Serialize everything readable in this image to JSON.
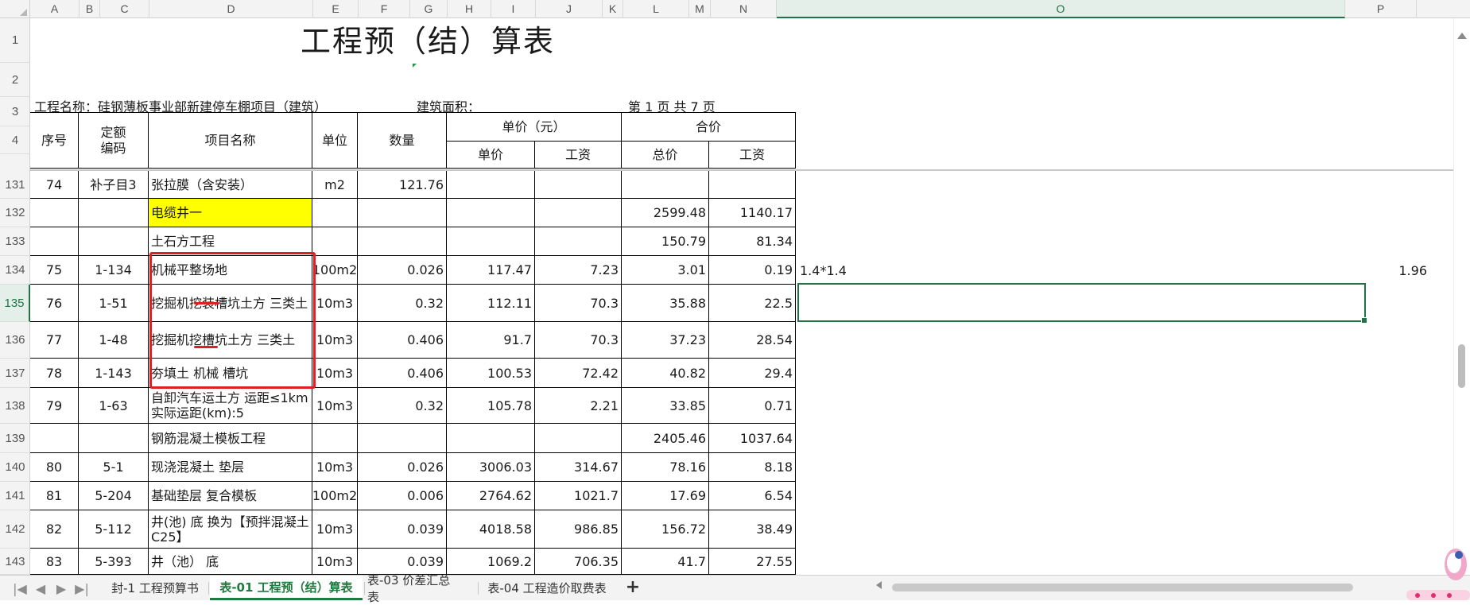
{
  "columns": [
    {
      "name": "A",
      "width": 62
    },
    {
      "name": "B",
      "width": 26
    },
    {
      "name": "C",
      "width": 62
    },
    {
      "name": "D",
      "width": 206
    },
    {
      "name": "E",
      "width": 57
    },
    {
      "name": "F",
      "width": 65
    },
    {
      "name": "G",
      "width": 47
    },
    {
      "name": "H",
      "width": 55
    },
    {
      "name": "I",
      "width": 56
    },
    {
      "name": "J",
      "width": 84
    },
    {
      "name": "K",
      "width": 26
    },
    {
      "name": "L",
      "width": 83
    },
    {
      "name": "M",
      "width": 27
    },
    {
      "name": "N",
      "width": 83
    },
    {
      "name": "O",
      "width": 715
    },
    {
      "name": "P",
      "width": 90
    }
  ],
  "row_labels": [
    "1",
    "2",
    "3",
    "4",
    "131",
    "132",
    "133",
    "134",
    "135",
    "136",
    "137",
    "138",
    "139",
    "140",
    "141",
    "142",
    "143"
  ],
  "selected_row": "135",
  "selected_column": "O",
  "sheet": {
    "title": "工程预（结）算表",
    "project_name": "工程名称：硅钢薄板事业部新建停车棚项目（建筑）",
    "building_area": "建筑面积：",
    "page_info": "第  1  页  共  7  页",
    "headers": {
      "seq": "序号",
      "quota_code": "定额\n编码",
      "item_name": "项目名称",
      "unit": "单位",
      "quantity": "数量",
      "unit_price_group": "单价（元）",
      "unit_price": "单价",
      "wage": "工资",
      "total_group": "合价",
      "total_price": "总价",
      "total_wage": "工资"
    },
    "rows": [
      {
        "row": "131",
        "seq": "74",
        "code": "补子目3",
        "name": "张拉膜（含安装）",
        "unit": "m2",
        "qty": "121.76",
        "price": "",
        "wage": "",
        "total": "",
        "twage": "",
        "highlight": false
      },
      {
        "row": "132",
        "seq": "",
        "code": "",
        "name": "电缆井一",
        "unit": "",
        "qty": "",
        "price": "",
        "wage": "",
        "total": "2599.48",
        "twage": "1140.17",
        "highlight": true
      },
      {
        "row": "133",
        "seq": "",
        "code": "",
        "name": "土石方工程",
        "unit": "",
        "qty": "",
        "price": "",
        "wage": "",
        "total": "150.79",
        "twage": "81.34",
        "highlight": false
      },
      {
        "row": "134",
        "seq": "75",
        "code": "1-134",
        "name": "机械平整场地",
        "unit": "100m2",
        "qty": "0.026",
        "price": "117.47",
        "wage": "7.23",
        "total": "3.01",
        "twage": "0.19",
        "highlight": false
      },
      {
        "row": "135",
        "seq": "76",
        "code": "1-51",
        "name": "挖掘机挖装槽坑土方 三类土",
        "unit": "10m3",
        "qty": "0.32",
        "price": "112.11",
        "wage": "70.3",
        "total": "35.88",
        "twage": "22.5",
        "highlight": false
      },
      {
        "row": "136",
        "seq": "77",
        "code": "1-48",
        "name": "挖掘机挖槽坑土方 三类土",
        "unit": "10m3",
        "qty": "0.406",
        "price": "91.7",
        "wage": "70.3",
        "total": "37.23",
        "twage": "28.54",
        "highlight": false
      },
      {
        "row": "137",
        "seq": "78",
        "code": "1-143",
        "name": "夯填土 机械 槽坑",
        "unit": "10m3",
        "qty": "0.406",
        "price": "100.53",
        "wage": "72.42",
        "total": "40.82",
        "twage": "29.4",
        "highlight": false
      },
      {
        "row": "138",
        "seq": "79",
        "code": "1-63",
        "name": "自卸汽车运土方 运距≤1km  实际运距(km):5",
        "unit": "10m3",
        "qty": "0.32",
        "price": "105.78",
        "wage": "2.21",
        "total": "33.85",
        "twage": "0.71",
        "highlight": false
      },
      {
        "row": "139",
        "seq": "",
        "code": "",
        "name": "钢筋混凝土模板工程",
        "unit": "",
        "qty": "",
        "price": "",
        "wage": "",
        "total": "2405.46",
        "twage": "1037.64",
        "highlight": false
      },
      {
        "row": "140",
        "seq": "80",
        "code": "5-1",
        "name": "现浇混凝土 垫层",
        "unit": "10m3",
        "qty": "0.026",
        "price": "3006.03",
        "wage": "314.67",
        "total": "78.16",
        "twage": "8.18",
        "highlight": false
      },
      {
        "row": "141",
        "seq": "81",
        "code": "5-204",
        "name": "基础垫层 复合模板",
        "unit": "100m2",
        "qty": "0.006",
        "price": "2764.62",
        "wage": "1021.7",
        "total": "17.69",
        "twage": "6.54",
        "highlight": false
      },
      {
        "row": "142",
        "seq": "82",
        "code": "5-112",
        "name": "井(池) 底  换为【预拌混凝土 C25】",
        "unit": "10m3",
        "qty": "0.039",
        "price": "4018.58",
        "wage": "986.85",
        "total": "156.72",
        "twage": "38.49",
        "highlight": false
      },
      {
        "row": "143",
        "seq": "83",
        "code": "5-393",
        "name": "井（池） 底",
        "unit": "10m3",
        "qty": "0.039",
        "price": "1069.2",
        "wage": "706.35",
        "total": "41.7",
        "twage": "27.55",
        "highlight": false
      }
    ],
    "side_notes": {
      "o134": "1.4*1.4",
      "p134": "1.96"
    }
  },
  "tabs": [
    {
      "label": "封-1 工程预算书",
      "active": false
    },
    {
      "label": "表-01 工程预（结）算表",
      "active": true
    },
    {
      "label": "表-03 价差汇总表",
      "active": false
    },
    {
      "label": "表-04 工程造价取费表",
      "active": false
    }
  ],
  "tab_nav": [
    "|◀",
    "◀",
    "▶",
    "▶|"
  ],
  "add_sheet_label": "+",
  "colors": {
    "selection": "#217346",
    "annotation": "#e02020",
    "highlight": "#ffff00",
    "active_tab": "#1f7a3f"
  }
}
